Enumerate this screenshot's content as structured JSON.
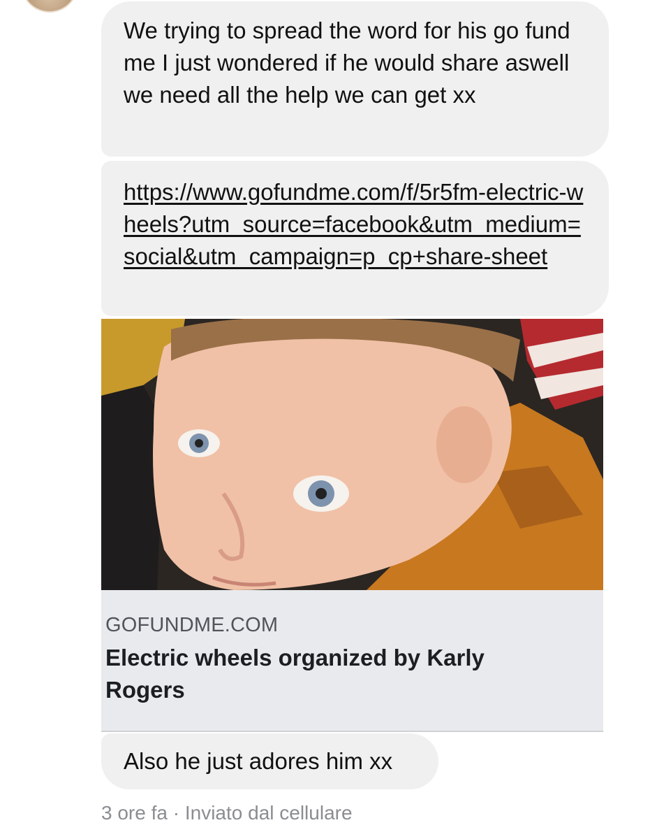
{
  "conversation": {
    "messages": [
      {
        "text": "We trying to spread the word for his go fund me I just wondered if he would share aswell we need all the help we can get xx"
      },
      {
        "link": "https://www.gofundme.com/f/5r5fm-electric-wheels?utm_source=facebook&utm_medium=social&utm_campaign=p_cp+share-sheet"
      },
      {
        "text": "Also he just adores him xx"
      }
    ],
    "link_preview": {
      "domain": "GOFUNDME.COM",
      "title": "Electric wheels organized by Karly Rogers"
    },
    "footer": {
      "timestamp": "3 ore fa",
      "separator": "·",
      "sent_from": "Inviato dal cellulare"
    }
  },
  "colors": {
    "bubble_background": "#f0f0f0",
    "card_background": "#e9eaed",
    "meta_text": "#8a8d91"
  }
}
